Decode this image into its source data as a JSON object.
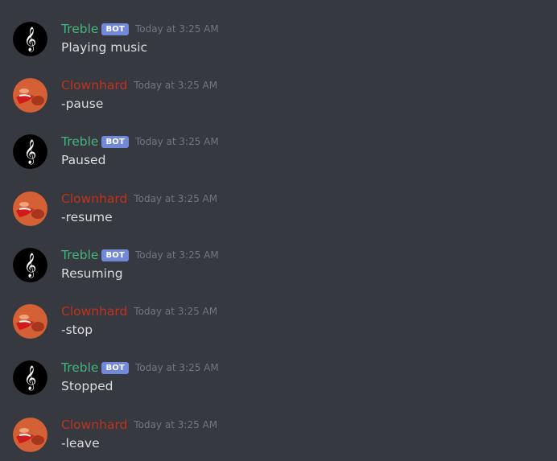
{
  "colors": {
    "background": "#36393f",
    "bot_name": "#43b581",
    "user_name": "#c0321e",
    "bot_tag": "#7289da",
    "timestamp": "#72767d",
    "text": "#dcddde"
  },
  "messages": [
    {
      "author": "Treble",
      "is_bot": true,
      "bot_tag": "BOT",
      "avatar_icon": "treble-clef-icon",
      "timestamp": "Today at 3:25 AM",
      "content": "Playing music"
    },
    {
      "author": "Clownhard",
      "is_bot": false,
      "bot_tag": "",
      "avatar_icon": "red-face-avatar",
      "timestamp": "Today at 3:25 AM",
      "content": "-pause"
    },
    {
      "author": "Treble",
      "is_bot": true,
      "bot_tag": "BOT",
      "avatar_icon": "treble-clef-icon",
      "timestamp": "Today at 3:25 AM",
      "content": "Paused"
    },
    {
      "author": "Clownhard",
      "is_bot": false,
      "bot_tag": "",
      "avatar_icon": "red-face-avatar",
      "timestamp": "Today at 3:25 AM",
      "content": "-resume"
    },
    {
      "author": "Treble",
      "is_bot": true,
      "bot_tag": "BOT",
      "avatar_icon": "treble-clef-icon",
      "timestamp": "Today at 3:25 AM",
      "content": "Resuming"
    },
    {
      "author": "Clownhard",
      "is_bot": false,
      "bot_tag": "",
      "avatar_icon": "red-face-avatar",
      "timestamp": "Today at 3:25 AM",
      "content": "-stop"
    },
    {
      "author": "Treble",
      "is_bot": true,
      "bot_tag": "BOT",
      "avatar_icon": "treble-clef-icon",
      "timestamp": "Today at 3:25 AM",
      "content": "Stopped"
    },
    {
      "author": "Clownhard",
      "is_bot": false,
      "bot_tag": "",
      "avatar_icon": "red-face-avatar",
      "timestamp": "Today at 3:25 AM",
      "content": "-leave"
    }
  ]
}
